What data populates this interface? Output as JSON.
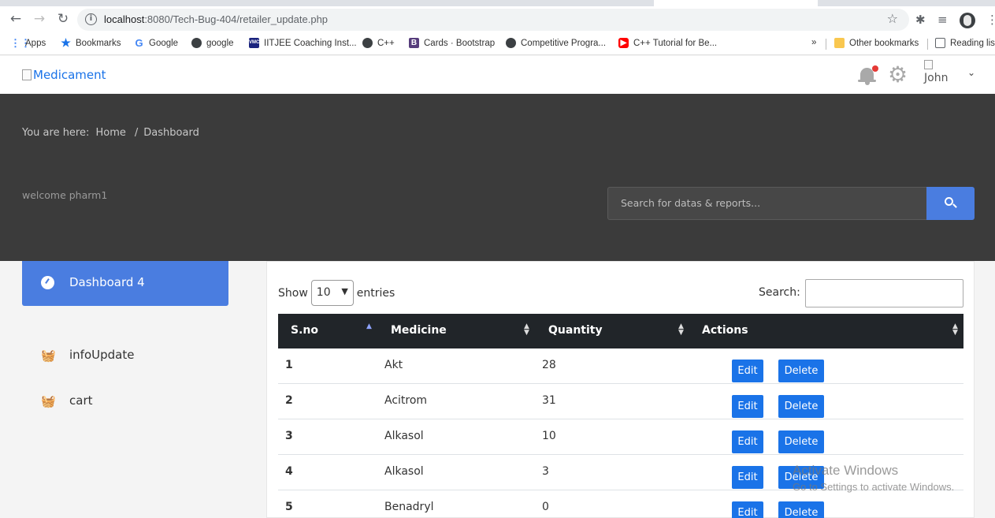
{
  "browser": {
    "url_host": "localhost",
    "url_path": ":8080/Tech-Bug-404/retailer_update.php",
    "bookmarks": [
      {
        "label": "Apps",
        "icon": "apps-grid-icon"
      },
      {
        "label": "Bookmarks",
        "icon": "star-icon"
      },
      {
        "label": "Google",
        "icon": "google-icon"
      },
      {
        "label": "google",
        "icon": "globe-icon"
      },
      {
        "label": "IITJEE Coaching Inst...",
        "icon": "vmc-icon"
      },
      {
        "label": "C++",
        "icon": "globe-icon"
      },
      {
        "label": "Cards · Bootstrap",
        "icon": "bootstrap-icon"
      },
      {
        "label": "Competitive Progra...",
        "icon": "globe-icon"
      },
      {
        "label": "C++ Tutorial for Be...",
        "icon": "youtube-icon"
      },
      {
        "label": "»",
        "icon": ""
      },
      {
        "label": "Other bookmarks",
        "icon": "folder-icon"
      },
      {
        "label": "Reading lis",
        "icon": "reading-list-icon"
      }
    ]
  },
  "header": {
    "logo_alt": "Medicament",
    "user_name": "John"
  },
  "banner": {
    "crumb_prefix": "You are here:",
    "crumb_home": "Home",
    "crumb_sep": "/",
    "crumb_current": "Dashboard",
    "welcome": "welcome pharm1",
    "search_placeholder": "Search for datas & reports..."
  },
  "sidebar": {
    "items": [
      {
        "label": "Dashboard 4",
        "active": true
      },
      {
        "label": "infoUpdate",
        "active": false
      },
      {
        "label": "cart",
        "active": false
      }
    ]
  },
  "table": {
    "show_label": "Show",
    "entries_value": "10",
    "entries_label": "entries",
    "search_label": "Search:",
    "columns": [
      "S.no",
      "Medicine",
      "Quantity",
      "Actions"
    ],
    "rows": [
      {
        "sno": "1",
        "medicine": "Akt",
        "quantity": "28"
      },
      {
        "sno": "2",
        "medicine": "Acitrom",
        "quantity": "31"
      },
      {
        "sno": "3",
        "medicine": "Alkasol",
        "quantity": "10"
      },
      {
        "sno": "4",
        "medicine": "Alkasol",
        "quantity": "3"
      },
      {
        "sno": "5",
        "medicine": "Benadryl",
        "quantity": "0"
      }
    ],
    "edit_label": "Edit",
    "delete_label": "Delete"
  },
  "watermark": {
    "line1": "Activate Windows",
    "line2": "Go to Settings to activate Windows."
  },
  "colors": {
    "accent": "#4a7de0",
    "button": "#1a73e8",
    "banner": "#3b3b3b",
    "table_head": "#212529"
  }
}
